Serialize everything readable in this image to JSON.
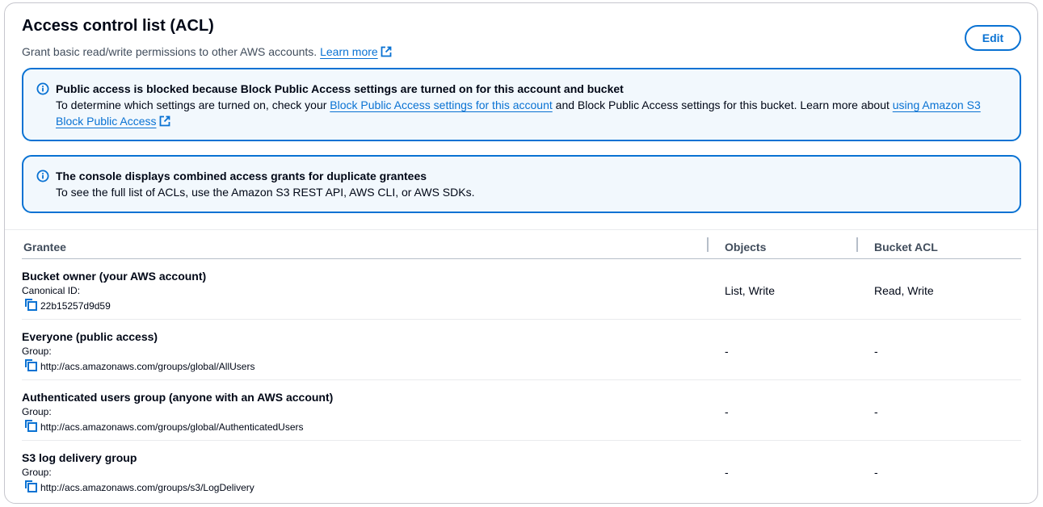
{
  "header": {
    "title": "Access control list (ACL)",
    "description": "Grant basic read/write permissions to other AWS accounts.",
    "learn_more": "Learn more",
    "edit_label": "Edit"
  },
  "alert_public": {
    "title": "Public access is blocked because Block Public Access settings are turned on for this account and bucket",
    "body_1": "To determine which settings are turned on, check your ",
    "link_1": "Block Public Access settings for this account",
    "body_2": " and Block Public Access settings for this bucket. Learn more about ",
    "link_2_line1": "using Amazon S3",
    "link_2_line2": "Block Public Access"
  },
  "alert_console": {
    "title": "The console displays combined access grants for duplicate grantees",
    "body": "To see the full list of ACLs, use the Amazon S3 REST API, AWS CLI, or AWS SDKs."
  },
  "table": {
    "columns": [
      "Grantee",
      "Objects",
      "Bucket ACL"
    ],
    "rows": [
      {
        "name": "Bucket owner (your AWS account)",
        "label": "Canonical ID:",
        "value": "22b15257d9d59",
        "objects": "List, Write",
        "bucket_acl": "Read, Write"
      },
      {
        "name": "Everyone (public access)",
        "label": "Group:",
        "value": "http://acs.amazonaws.com/groups/global/AllUsers",
        "objects": "-",
        "bucket_acl": "-"
      },
      {
        "name": "Authenticated users group (anyone with an AWS account)",
        "label": "Group:",
        "value": "http://acs.amazonaws.com/groups/global/AuthenticatedUsers",
        "objects": "-",
        "bucket_acl": "-"
      },
      {
        "name": "S3 log delivery group",
        "label": "Group:",
        "value": "http://acs.amazonaws.com/groups/s3/LogDelivery",
        "objects": "-",
        "bucket_acl": "-"
      }
    ]
  },
  "colors": {
    "accent": "#0972d3",
    "info_bg": "#f2f8fd",
    "border": "#c6c6cd"
  },
  "icons": [
    "info-icon",
    "external-link-icon",
    "copy-icon"
  ]
}
